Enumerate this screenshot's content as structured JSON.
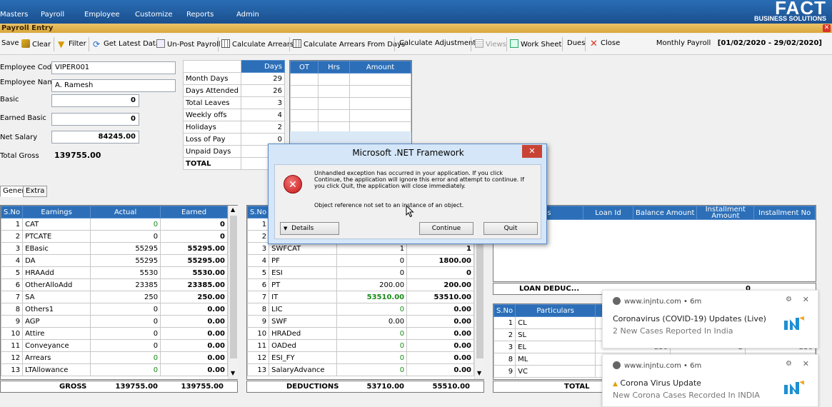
{
  "menu": [
    "Masters",
    "Payroll",
    "Employee",
    "Customize",
    "Reports",
    "Admin"
  ],
  "logo": {
    "text": "FACT",
    "tagline": "BUSINESS SOLUTIONS"
  },
  "window_title": "Payroll Entry",
  "toolbar": {
    "save": "Save",
    "clear": "Clear",
    "filter": "Filter",
    "get_latest": "Get Latest Data",
    "unpost": "Un-Post Payroll",
    "calc_arrears": "Calculate Arrears",
    "calc_arrears_days": "Calculate Arrears From Days",
    "calc_adjust": "Calculate Adjustments",
    "views": "Views",
    "worksheet": "Work Sheet",
    "dues": "Dues",
    "close": "Close",
    "period_label": "Monthly Payroll",
    "period_value": "[01/02/2020 - 29/02/2020]"
  },
  "employee": {
    "code_label": "Employee Code",
    "code": "VIPER001",
    "name_label": "Employee Name",
    "name": "A. Ramesh",
    "basic_label": "Basic",
    "basic": "0",
    "earned_basic_label": "Earned Basic",
    "earned_basic": "0",
    "net_salary_label": "Net Salary",
    "net_salary": "84245.00",
    "total_gross_label": "Total Gross",
    "total_gross": "139755.00"
  },
  "days": {
    "header": "Days",
    "rows": [
      {
        "label": "Month Days",
        "value": "29"
      },
      {
        "label": "Days Attended",
        "value": "26"
      },
      {
        "label": "Total Leaves",
        "value": "3"
      },
      {
        "label": "Weekly offs",
        "value": "4"
      },
      {
        "label": "Holidays",
        "value": "2"
      },
      {
        "label": "Loss of Pay",
        "value": "0"
      },
      {
        "label": "Unpaid Days",
        "value": ""
      },
      {
        "label": "TOTAL",
        "value": ""
      }
    ]
  },
  "ot": {
    "headers": [
      "OT",
      "Hrs",
      "Amount"
    ]
  },
  "tabs": [
    "General",
    "Extra"
  ],
  "earnings": {
    "headers": [
      "S.No",
      "Earnings",
      "Actual",
      "Earned"
    ],
    "rows": [
      [
        "1",
        "CAT",
        "0",
        "0"
      ],
      [
        "2",
        "PTCATE",
        "0",
        "0"
      ],
      [
        "3",
        "EBasic",
        "55295",
        "55295.00"
      ],
      [
        "4",
        "DA",
        "55295",
        "55295.00"
      ],
      [
        "5",
        "HRAAdd",
        "5530",
        "5530.00"
      ],
      [
        "6",
        "OtherAlloAdd",
        "23385",
        "23385.00"
      ],
      [
        "7",
        "SA",
        "250",
        "250.00"
      ],
      [
        "8",
        "Others1",
        "0",
        "0.00"
      ],
      [
        "9",
        "AGP",
        "0",
        "0.00"
      ],
      [
        "10",
        "Attire",
        "0",
        "0.00"
      ],
      [
        "11",
        "Conveyance",
        "0",
        "0.00"
      ],
      [
        "12",
        "Arrears",
        "0",
        "0.00"
      ],
      [
        "13",
        "LTAllowance",
        "0",
        "0.00"
      ]
    ],
    "footer_label": "GROSS",
    "footer_actual": "139755.00",
    "footer_earned": "139755.00"
  },
  "deductions": {
    "header_sno": "S.No",
    "rows": [
      [
        "1",
        "",
        "",
        ""
      ],
      [
        "2",
        "",
        "",
        ""
      ],
      [
        "3",
        "SWFCAT",
        "1",
        "1"
      ],
      [
        "4",
        "PF",
        "0",
        "1800.00"
      ],
      [
        "5",
        "ESI",
        "0",
        "0"
      ],
      [
        "6",
        "PT",
        "200.00",
        "200.00"
      ],
      [
        "7",
        "IT",
        "53510.00",
        "53510.00"
      ],
      [
        "8",
        "LIC",
        "0",
        "0.00"
      ],
      [
        "9",
        "SWF",
        "0.00",
        "0.00"
      ],
      [
        "10",
        "HRADed",
        "0",
        "0.00"
      ],
      [
        "11",
        "OADed",
        "0",
        "0.00"
      ],
      [
        "12",
        "ESI_FY",
        "0",
        "0.00"
      ],
      [
        "13",
        "SalaryAdvance",
        "0",
        "0.00"
      ]
    ],
    "footer_label": "DEDUCTIONS",
    "footer_actual": "53710.00",
    "footer_earned": "55510.00"
  },
  "loans": {
    "headers": [
      "ns",
      "Loan Id",
      "Balance Amount",
      "Installment Amount",
      "Installment No"
    ],
    "footer_label": "LOAN DEDUC...",
    "footer_value": "0"
  },
  "leaves": {
    "headers": [
      "S.No",
      "Particulars"
    ],
    "rows": [
      [
        "1",
        "CL"
      ],
      [
        "2",
        "SL"
      ],
      [
        "3",
        "EL"
      ],
      [
        "8",
        "ML"
      ],
      [
        "9",
        "VC"
      ]
    ],
    "extra_values": [
      "230",
      "2",
      "230"
    ],
    "footer_label": "TOTAL"
  },
  "dialog": {
    "title": "Microsoft .NET Framework",
    "message": "Unhandled exception has occurred in your application. If you click Continue, the application will ignore this error and attempt to continue. If you click Quit, the application will close immediately.",
    "detail": "Object reference not set to an instance of an object.",
    "details_btn": "Details",
    "continue_btn": "Continue",
    "quit_btn": "Quit"
  },
  "notifications": [
    {
      "source": "www.injntu.com",
      "age": "6m",
      "title": "Coronavirus (COVID-19) Updates (Live)",
      "subtitle": "2 New Cases Reported In India"
    },
    {
      "source": "www.injntu.com",
      "age": "6m",
      "title": "Corona Virus Update",
      "subtitle": "New Corona Cases Recorded In INDIA"
    }
  ],
  "colors": {
    "menubar": "#1f5a9e",
    "grid_header": "#2c6fb8",
    "title_bar": "#e2b651",
    "green_value": "#1a8a1a",
    "notif_logo": "#1e8fd0"
  }
}
